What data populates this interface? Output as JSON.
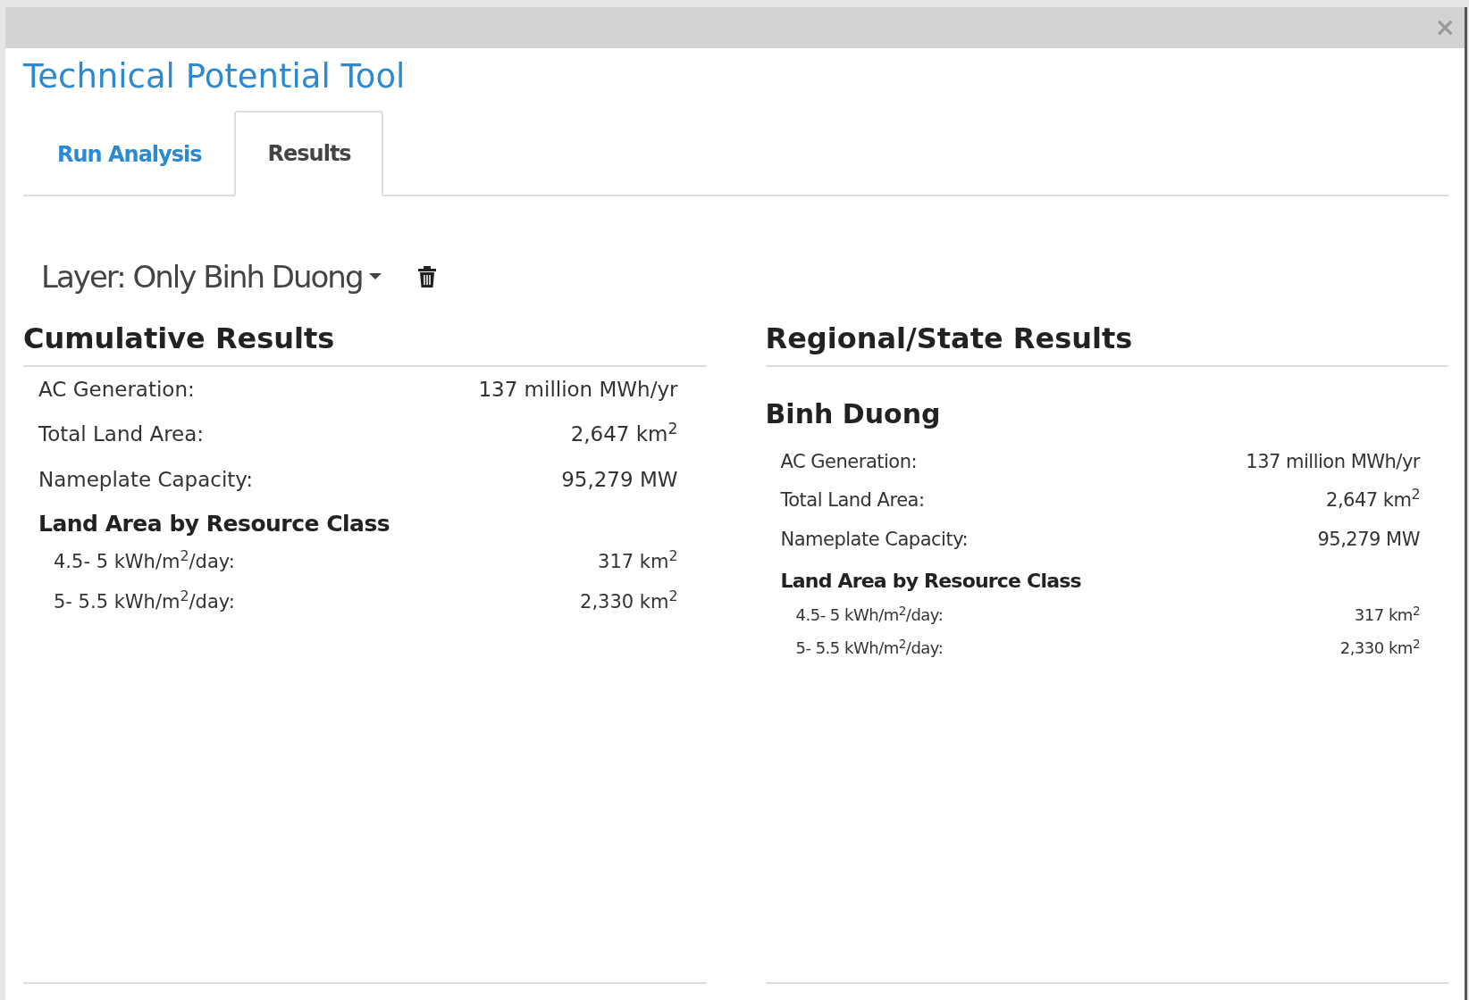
{
  "window": {
    "close": "×"
  },
  "title": "Technical Potential Tool",
  "tabs": [
    {
      "label": "Run Analysis",
      "selected": false
    },
    {
      "label": "Results",
      "selected": true
    }
  ],
  "layer": {
    "label": "Layer: Only Binh Duong"
  },
  "cumulative": {
    "heading": "Cumulative Results",
    "rows": [
      {
        "label": "AC Generation:",
        "value": "137 million MWh/yr"
      },
      {
        "label": "Total Land Area:",
        "value": "2,647 km$^{2}$"
      },
      {
        "label": "Nameplate Capacity:",
        "value": "95,279 MW"
      }
    ],
    "subheading": "Land Area by Resource Class",
    "classes": [
      {
        "label": "4.5- 5 kWh/m$^{2}$/day:",
        "value": "317 km$^{2}$"
      },
      {
        "label": "5- 5.5 kWh/m$^{2}$/day:",
        "value": "2,330 km$^{2}$"
      }
    ]
  },
  "regional": {
    "heading": "Regional/State Results",
    "regions": [
      {
        "name": "Binh Duong",
        "rows": [
          {
            "label": "AC Generation:",
            "value": "137 million MWh/yr"
          },
          {
            "label": "Total Land Area:",
            "value": "2,647 km$^{2}$"
          },
          {
            "label": "Nameplate Capacity:",
            "value": "95,279 MW"
          }
        ],
        "subheading": "Land Area by Resource Class",
        "classes": [
          {
            "label": "4.5- 5 kWh/m$^{2}$/day:",
            "value": "317 km$^{2}$"
          },
          {
            "label": "5- 5.5 kWh/m$^{2}$/day:",
            "value": "2,330 km$^{2}$"
          }
        ]
      }
    ]
  }
}
